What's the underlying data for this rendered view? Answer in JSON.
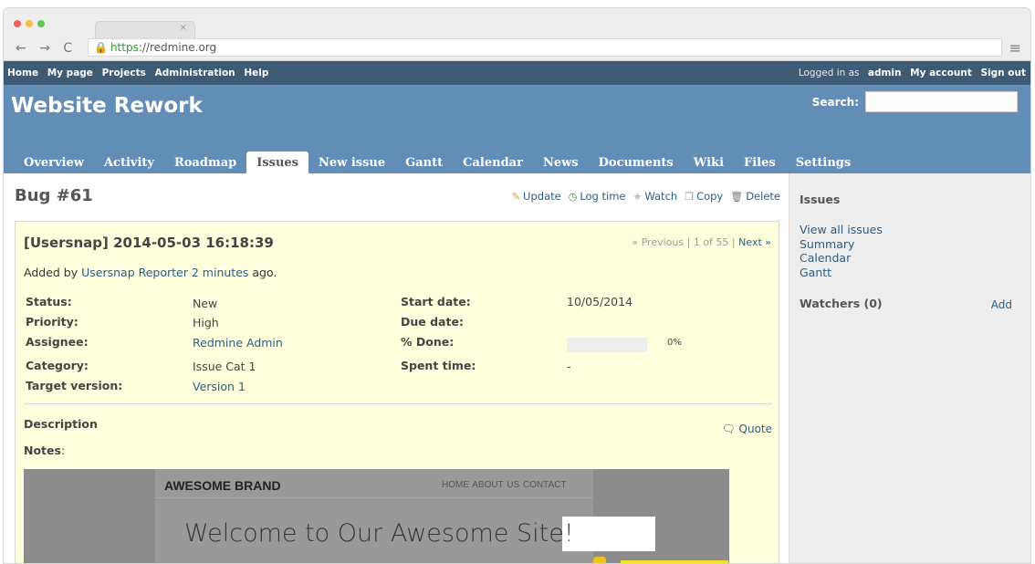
{
  "browser": {
    "tab_close": "×",
    "nav": "← → C",
    "url_scheme": "https",
    "url_rest": "://redmine.org",
    "menu_icon": "≡"
  },
  "topmenu": {
    "left": [
      "Home",
      "My page",
      "Projects",
      "Administration",
      "Help"
    ],
    "logged_in_prefix": "Logged in as",
    "user": "admin",
    "my_account": "My account",
    "sign_out": "Sign out"
  },
  "header": {
    "project": "Website Rework",
    "search_label": "Search:",
    "search_value": ""
  },
  "mainmenu": [
    "Overview",
    "Activity",
    "Roadmap",
    "Issues",
    "New issue",
    "Gantt",
    "Calendar",
    "News",
    "Documents",
    "Wiki",
    "Files",
    "Settings"
  ],
  "issue": {
    "title": "Bug #61",
    "actions": {
      "update": "Update",
      "log_time": "Log time",
      "watch": "Watch",
      "copy": "Copy",
      "delete": "Delete"
    },
    "subject": "[Usersnap] 2014-05-03 16:18:39",
    "prev": "« Previous",
    "sep1": "|",
    "position": "1 of 55",
    "sep2": "|",
    "next": "Next »",
    "added_by": "Added by",
    "author": "Usersnap Reporter",
    "age": "2 minutes",
    "ago": "ago.",
    "attributes": {
      "status_label": "Status:",
      "status": "New",
      "priority_label": "Priority:",
      "priority": "High",
      "assignee_label": "Assignee:",
      "assignee": "Redmine Admin",
      "category_label": "Category:",
      "category": "Issue Cat 1",
      "target_version_label": "Target version:",
      "target_version": "Version 1",
      "start_date_label": "Start date:",
      "start_date": "10/05/2014",
      "due_date_label": "Due date:",
      "due_date": "",
      "done_label": "% Done:",
      "done": "0%",
      "spent_time_label": "Spent time:",
      "spent_time": "-"
    },
    "done_fraction": 0,
    "description_label": "Description",
    "quote": "Quote",
    "notes_label": "Notes",
    "notes_colon": ":"
  },
  "screenshot": {
    "brand": "AWESOME BRAND",
    "nav": "HOME  ABOUT US  CONTACT",
    "headline_a": "Welcome to Our Awesom",
    "headline_b": "e Site!"
  },
  "sidebar": {
    "issues_title": "Issues",
    "links": [
      "View all issues",
      "Summary",
      "Calendar",
      "Gantt"
    ],
    "watchers": "Watchers (0)",
    "add": "Add"
  }
}
